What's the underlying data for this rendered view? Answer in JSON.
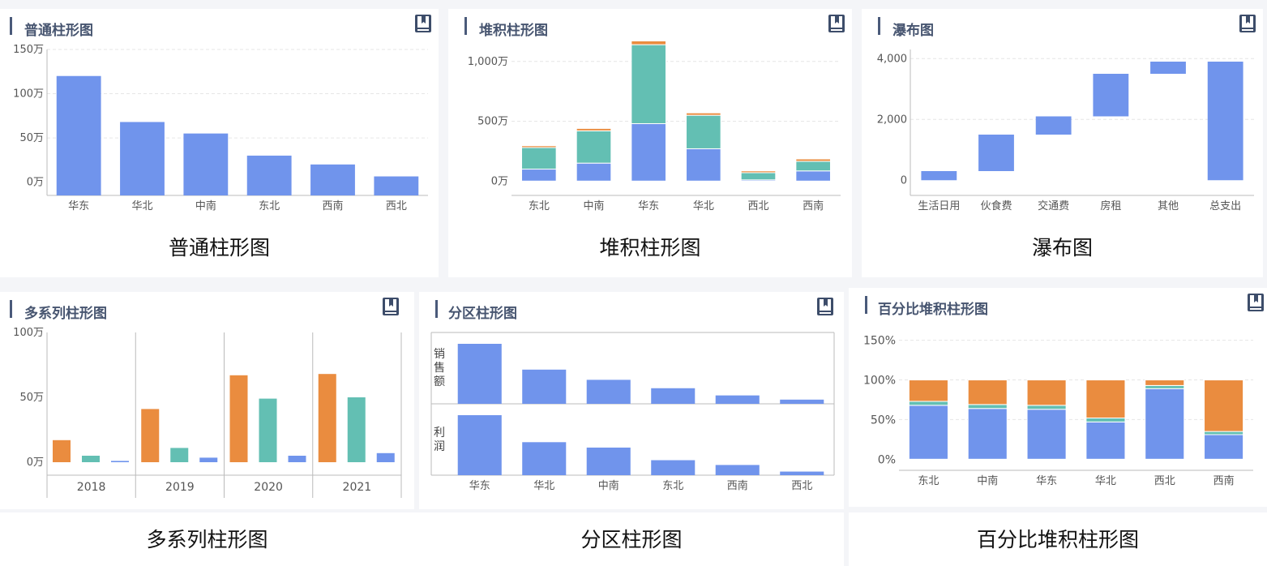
{
  "colors": {
    "blue": "#7094ec",
    "teal": "#63bfb3",
    "orange": "#ea8c3f",
    "axis": "#bbbbbb",
    "grid": "#e6e6e6",
    "tick": "#555555"
  },
  "icons": {
    "card_action": "book-icon"
  },
  "panels": [
    {
      "title": "普通柱形图",
      "caption": "普通柱形图"
    },
    {
      "title": "堆积柱形图",
      "caption": "堆积柱形图"
    },
    {
      "title": "瀑布图",
      "caption": "瀑布图"
    },
    {
      "title": "多系列柱形图",
      "caption": "多系列柱形图"
    },
    {
      "title": "分区柱形图",
      "caption": "分区柱形图"
    },
    {
      "title": "百分比堆积柱形图",
      "caption": "百分比堆积柱形图"
    }
  ],
  "chart_data": [
    {
      "type": "bar",
      "title": "普通柱形图",
      "categories": [
        "华东",
        "华北",
        "中南",
        "东北",
        "西南",
        "西北"
      ],
      "values": [
        1200000,
        680000,
        550000,
        300000,
        200000,
        65000
      ],
      "y_ticks": [
        "0万",
        "50万",
        "100万",
        "150万"
      ],
      "ylim": [
        -150000,
        1500000
      ],
      "grid": true
    },
    {
      "type": "bar",
      "stacked": true,
      "title": "堆积柱形图",
      "categories": [
        "东北",
        "中南",
        "华东",
        "华北",
        "西北",
        "西南"
      ],
      "series": [
        {
          "values": [
            1000000,
            1500000,
            4800000,
            2700000,
            100000,
            850000
          ]
        },
        {
          "values": [
            1800000,
            2700000,
            6600000,
            2800000,
            600000,
            800000
          ]
        },
        {
          "values": [
            150000,
            200000,
            450000,
            200000,
            150000,
            200000
          ]
        }
      ],
      "y_ticks": [
        "0万",
        "500万",
        "1,000万"
      ],
      "ylim": [
        -1200000,
        11000000
      ],
      "grid": true
    },
    {
      "type": "bar",
      "subtype": "waterfall",
      "title": "瀑布图",
      "categories": [
        "生活日用",
        "伙食费",
        "交通费",
        "房租",
        "其他",
        "总支出"
      ],
      "values": [
        300,
        1200,
        600,
        1400,
        400,
        3900
      ],
      "y_ticks": [
        "0",
        "2,000",
        "4,000"
      ],
      "ylim": [
        -500,
        4300
      ],
      "grid": true
    },
    {
      "type": "bar",
      "title": "多系列柱形图",
      "categories": [
        "2018",
        "2019",
        "2020",
        "2021"
      ],
      "series": [
        {
          "values": [
            10000,
            35000,
            50000,
            70000
          ]
        },
        {
          "values": [
            50000,
            110000,
            490000,
            500000
          ]
        },
        {
          "values": [
            170000,
            410000,
            670000,
            680000
          ]
        }
      ],
      "y_ticks": [
        "0万",
        "50万",
        "100万"
      ],
      "ylim": [
        -100000,
        1000000
      ],
      "grid": false
    },
    {
      "type": "bar",
      "subtype": "faceted",
      "title": "分区柱形图",
      "categories": [
        "华东",
        "华北",
        "中南",
        "东北",
        "西南",
        "西北"
      ],
      "series": [
        {
          "name": "销售额",
          "values": [
            1.0,
            0.57,
            0.4,
            0.26,
            0.14,
            0.07
          ]
        },
        {
          "name": "利润",
          "values": [
            1.0,
            0.55,
            0.46,
            0.25,
            0.17,
            0.06
          ]
        }
      ],
      "grid": false
    },
    {
      "type": "bar",
      "stacked": true,
      "percent": true,
      "title": "百分比堆积柱形图",
      "categories": [
        "东北",
        "中南",
        "华东",
        "华北",
        "西北",
        "西南"
      ],
      "series": [
        {
          "values": [
            68,
            64,
            63,
            47,
            89,
            31
          ]
        },
        {
          "values": [
            5,
            5,
            5,
            5,
            4,
            4
          ]
        },
        {
          "values": [
            27,
            31,
            32,
            48,
            7,
            65
          ]
        }
      ],
      "y_ticks": [
        "0%",
        "50%",
        "100%",
        "150%"
      ],
      "ylim": [
        -14,
        165
      ],
      "grid": true
    }
  ]
}
